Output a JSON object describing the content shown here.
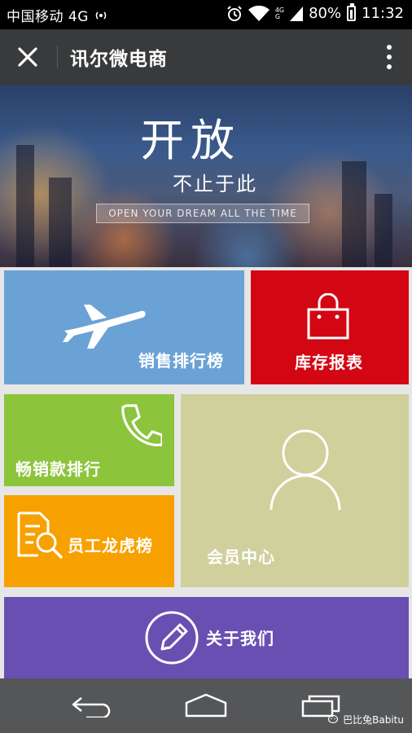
{
  "status_bar": {
    "carrier": "中国移动 4G",
    "network_small": "4G",
    "battery": "80%",
    "time": "11:32",
    "icons": [
      "hotspot-icon",
      "alarm-icon",
      "wifi-icon",
      "signal-icon",
      "battery-icon"
    ]
  },
  "header": {
    "title": "讯尔微电商",
    "close_icon": "close-icon",
    "more_icon": "more-vertical-icon"
  },
  "banner": {
    "headline": "开放",
    "subline": "不止于此",
    "english": "OPEN YOUR DREAM ALL THE TIME"
  },
  "tiles": {
    "sales": {
      "label": "销售排行榜",
      "icon": "airplane-icon",
      "color": "#6aa2d6"
    },
    "stock": {
      "label": "库存报表",
      "icon": "shopping-bag-icon",
      "color": "#d30613"
    },
    "best": {
      "label": "畅销款排行",
      "icon": "phone-icon",
      "color": "#8cc43b"
    },
    "staff": {
      "label": "员工龙虎榜",
      "icon": "document-search-icon",
      "color": "#f7a100"
    },
    "member": {
      "label": "会员中心",
      "icon": "user-icon",
      "color": "#cfd09c"
    },
    "about": {
      "label": "关于我们",
      "icon": "edit-pencil-icon",
      "color": "#6a4fb3"
    }
  },
  "nav": {
    "icons": [
      "back-icon",
      "home-icon",
      "recents-icon"
    ],
    "watermark": "巴比兔Babitu"
  }
}
